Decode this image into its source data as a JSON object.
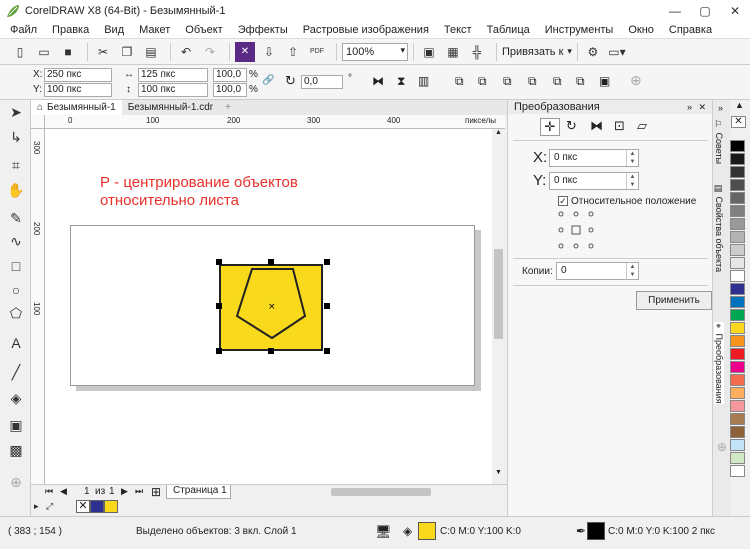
{
  "window": {
    "title": "CorelDRAW X8 (64-Bit) - Безымянный-1"
  },
  "menu": [
    "Файл",
    "Правка",
    "Вид",
    "Макет",
    "Объект",
    "Эффекты",
    "Растровые изображения",
    "Текст",
    "Таблица",
    "Инструменты",
    "Окно",
    "Справка"
  ],
  "toolbar": {
    "zoom": "100%",
    "snap_label": "Привязать к",
    "pdf_label": "PDF"
  },
  "props": {
    "x_label": "X:",
    "x_value": "250 пкс",
    "y_label": "Y:",
    "y_value": "100 пкс",
    "w_value": "125 пкс",
    "h_value": "100 пкс",
    "sx_value": "100,0",
    "sy_value": "100,0",
    "percent": "%",
    "rotation": "0,0",
    "deg": "°"
  },
  "doc_tabs": [
    "Безымянный-1",
    "Безымянный-1.cdr"
  ],
  "ruler": {
    "h_ticks": [
      "0",
      "100",
      "200",
      "300",
      "400"
    ],
    "v_ticks": [
      "300",
      "200",
      "100"
    ],
    "units": "пикселы"
  },
  "annotation": {
    "line1": "Р - центрирование объектов",
    "line2": "относительно листа"
  },
  "pagenav": {
    "current": "1",
    "of": "из",
    "total": "1",
    "page_tab": "Страница 1"
  },
  "docker": {
    "title": "Преобразования",
    "x_label": "X:",
    "x_value": "0 пкс",
    "y_label": "Y:",
    "y_value": "0 пкс",
    "relative_label": "Относительное положение",
    "copies_label": "Копии:",
    "copies_value": "0",
    "apply_button": "Применить"
  },
  "side_tabs": [
    "Советы",
    "Свойства объекта",
    "Преобразования"
  ],
  "palette_colors": [
    "#000000",
    "#1a1a1a",
    "#333333",
    "#4d4d4d",
    "#666666",
    "#808080",
    "#999999",
    "#b3b3b3",
    "#cccccc",
    "#e6e6e6",
    "#ffffff",
    "#2e3192",
    "#0072bc",
    "#00a651",
    "#fbd61e",
    "#f7941d",
    "#ed1c24",
    "#ec008c",
    "#f26c4f",
    "#fbaf5d",
    "#f5989d",
    "#a67c52",
    "#8c6239",
    "#c2e3f5",
    "#d1e8c4",
    "#ffffff"
  ],
  "status": {
    "coords": "( 383 ; 154 )",
    "selection": "Выделено объектов: 3 вкл. Слой 1",
    "fill_text": "C:0 M:0 Y:100 K:0",
    "outline_text": "C:0 M:0 Y:0 K:100  2 пкс",
    "fill_color": "#f9d91c",
    "outline_color": "#000000"
  }
}
